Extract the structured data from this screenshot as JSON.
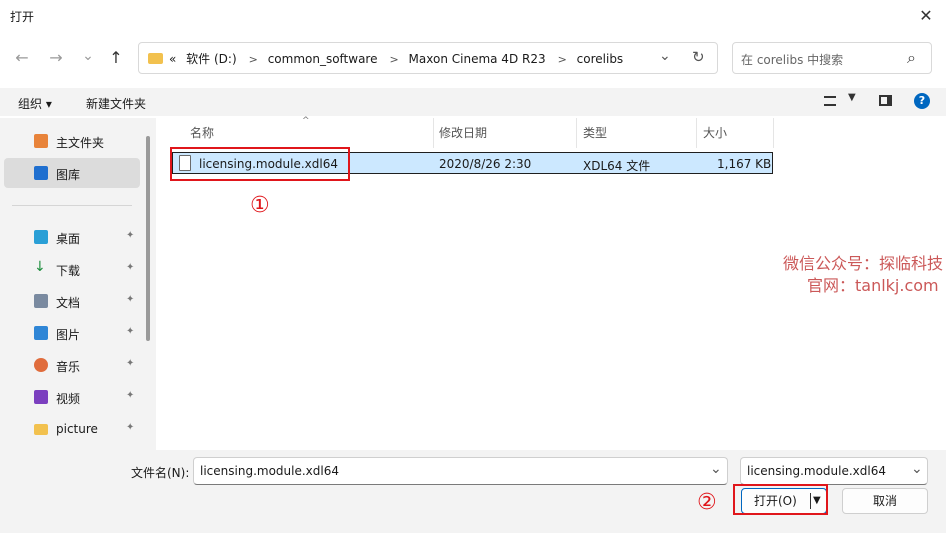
{
  "window": {
    "title": "打开",
    "close_glyph": "✕"
  },
  "nav": {
    "back": "←",
    "forward": "→",
    "recent": "⌄",
    "up": "↑",
    "breadcrumbs": [
      "«",
      "软件 (D:)",
      "common_software",
      "Maxon Cinema 4D R23",
      "corelibs"
    ],
    "dropdown": "⌄",
    "refresh": "↻",
    "search_placeholder": "在 corelibs 中搜索",
    "search_icon": "⌕"
  },
  "toolbar": {
    "organize": "组织 ▾",
    "new_folder": "新建文件夹"
  },
  "sidebar": {
    "top_items": [
      {
        "label": "主文件夹",
        "icon": "home-icon"
      },
      {
        "label": "图库",
        "icon": "gallery-icon"
      }
    ],
    "pinned_items": [
      {
        "label": "桌面",
        "icon": "desktop-icon"
      },
      {
        "label": "下载",
        "icon": "download-icon"
      },
      {
        "label": "文档",
        "icon": "documents-icon"
      },
      {
        "label": "图片",
        "icon": "pictures-icon"
      },
      {
        "label": "音乐",
        "icon": "music-icon"
      },
      {
        "label": "视频",
        "icon": "video-icon"
      },
      {
        "label": "picture",
        "icon": "folder-icon"
      }
    ],
    "pin_glyph": "📌"
  },
  "file_list": {
    "columns": [
      "名称",
      "修改日期",
      "类型",
      "大小"
    ],
    "rows": [
      {
        "name": "licensing.module.xdl64",
        "modified": "2020/8/26 2:30",
        "type": "XDL64 文件",
        "size": "1,167 KB"
      }
    ]
  },
  "annotations": {
    "step1": "①",
    "step2": "②"
  },
  "watermark": {
    "line1": "微信公众号：探临科技",
    "line2": "官网：tanlkj.com"
  },
  "footer": {
    "filename_label": "文件名(N):",
    "filename_value": "licensing.module.xdl64",
    "filter_value": "licensing.module.xdl64",
    "open_button": "打开(O)",
    "cancel_button": "取消"
  },
  "colors": {
    "accent": "#0067c0",
    "selection": "#cce8ff",
    "highlight_red": "#e0161b"
  }
}
